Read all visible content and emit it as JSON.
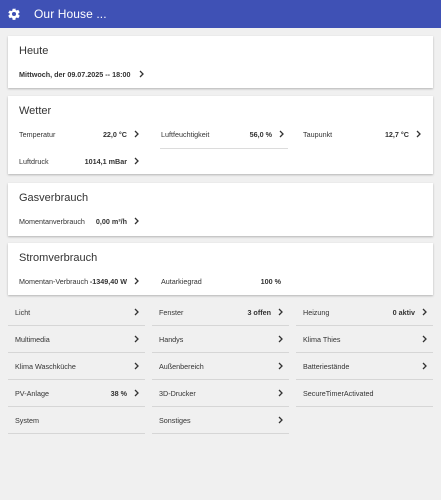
{
  "header": {
    "title": "Our House ..."
  },
  "heute": {
    "title": "Heute",
    "date": "Mittwoch, der 09.07.2025 -- 18:00"
  },
  "wetter": {
    "title": "Wetter",
    "temperature_label": "Temperatur",
    "temperature_value": "22,0 °C",
    "humidity_label": "Luftfeuchtigkeit",
    "humidity_value": "56,0 %",
    "dewpoint_label": "Taupunkt",
    "dewpoint_value": "12,7 °C",
    "pressure_label": "Luftdruck",
    "pressure_value": "1014,1 mBar"
  },
  "gas": {
    "title": "Gasverbrauch",
    "current_label": "Momentanverbrauch",
    "current_value": "0,00 m³/h"
  },
  "strom": {
    "title": "Stromverbrauch",
    "current_label": "Momentan-Verbrauch",
    "current_value": "-1349,40 W",
    "autarky_label": "Autarkiegrad",
    "autarky_value": "100 %"
  },
  "grid": {
    "col1": [
      {
        "label": "Licht",
        "value": ""
      },
      {
        "label": "Multimedia",
        "value": ""
      },
      {
        "label": "Klima Waschküche",
        "value": ""
      },
      {
        "label": "PV-Anlage",
        "value": "38 %"
      },
      {
        "label": "System",
        "value": ""
      }
    ],
    "col2": [
      {
        "label": "Fenster",
        "value": "3 offen"
      },
      {
        "label": "Handys",
        "value": ""
      },
      {
        "label": "Außenbereich",
        "value": ""
      },
      {
        "label": "3D-Drucker",
        "value": ""
      },
      {
        "label": "Sonstiges",
        "value": ""
      }
    ],
    "col3": [
      {
        "label": "Heizung",
        "value": "0 aktiv"
      },
      {
        "label": "Klima Thies",
        "value": ""
      },
      {
        "label": "Batteriestände",
        "value": ""
      },
      {
        "label": "SecureTimerActivated",
        "value": ""
      }
    ]
  }
}
